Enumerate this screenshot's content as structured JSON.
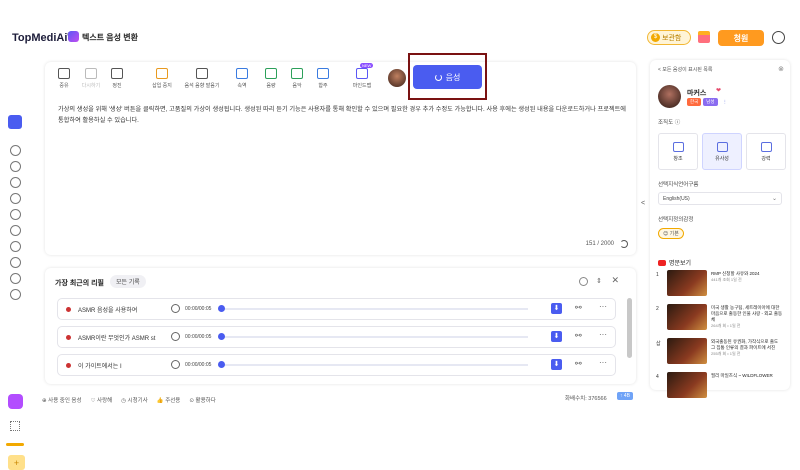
{
  "header": {
    "logo": "TopMediAi",
    "logo_sup": "®",
    "app_title": "텍스트 음성 변환",
    "coin": "보관함",
    "buy": "청원"
  },
  "toolbar": [
    {
      "label": "중유",
      "style": ""
    },
    {
      "label": "다시하기",
      "style": "dis"
    },
    {
      "label": "정진",
      "style": ""
    },
    {
      "label": "삽입 중지",
      "style": "o"
    },
    {
      "label": "음석 음향 발음기",
      "style": ""
    },
    {
      "label": "속역",
      "style": "b"
    },
    {
      "label": "음량",
      "style": "g"
    },
    {
      "label": "음악",
      "style": "g"
    },
    {
      "label": "합주",
      "style": "b"
    },
    {
      "label": "마인드맵",
      "style": "v"
    }
  ],
  "toolbar_new": "NEW",
  "generate_label": "음성",
  "editor_text": "가상의 생성을 위해 '생성' 버튼을 클릭하면, 고품질의 가상이 생성됩니다. 생성된 따리 듣기 기능은 사용자를 통해 확인할 수 있으며 필요한 경우 추가 수정도 가능합니다. 사용 후에는 생성된 내용을 다운로드하거나 프로젝트에 통합하여 활용하실 수 있습니다.",
  "char_counter": "151 / 2000",
  "collapse_label": "<",
  "recent": {
    "title": "가장 최근의 리필",
    "all_button": "모든 기록",
    "rows": [
      {
        "name": "ASMR 음성을 사용하여",
        "time": "00:00/00:05"
      },
      {
        "name": "ASMR이란 무엇인가 ASMR st",
        "time": "00:00/00:05"
      },
      {
        "name": "이 가이트에서는 I",
        "time": "00:00/00:05"
      }
    ]
  },
  "footer": {
    "items": [
      "사용 중인 음성",
      "사랑해",
      "시청기사",
      "주선용",
      "활용하다"
    ],
    "count": "화배수치: 376566",
    "badge": "↑ 4B"
  },
  "panel": {
    "header": "< 모든 음성이 표시된 목록",
    "close": "⊗",
    "voice_name": "마커스",
    "tags": [
      {
        "text": "한국",
        "color": "#ff6a3d"
      },
      {
        "text": "남성",
        "color": "#8a6cf0"
      }
    ],
    "style_label": "조직도 ⓘ",
    "styles": [
      {
        "label": "창조",
        "sel": false
      },
      {
        "label": "유사성",
        "sel": true
      },
      {
        "label": "강력",
        "sel": false
      }
    ],
    "lang_label": "선택지식언어구름",
    "lang_value": "English(US)",
    "emotion_label": "선택지정의감정",
    "emotion_value": "😊 기본",
    "rec_label": "명문보기",
    "videos": [
      {
        "num": "1",
        "title": "RMP 신청할 사유와 2024",
        "meta": "441개 조회 1일 전"
      },
      {
        "num": "2",
        "title": "미국 생활 농구팀, 세트레이아에 대한 마음으로 출동한 인물 사랑 - 외교 출동체",
        "meta": "264개 회 • 1일 전"
      },
      {
        "num": "삽",
        "title": "외국출동된 유권화, 가작식으로 출도 그 집통 인류의 결과 파이트에 서진",
        "meta": "255개 회 • 1일 전"
      },
      {
        "num": "4",
        "title": "필리 마일즈식 ~ WILDFLOWER",
        "meta": ""
      }
    ]
  }
}
